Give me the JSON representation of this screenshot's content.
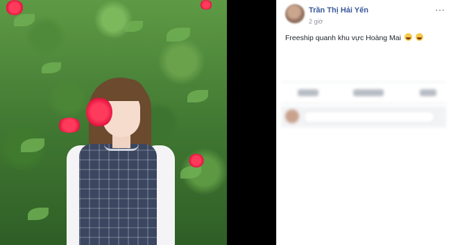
{
  "post": {
    "author": "Trần Thị Hải Yến",
    "time": "2 giờ",
    "more_icon": "⋯",
    "text": "Freeship quanh khu vực Hoàng Mai"
  },
  "icons": {
    "avatar": "avatar",
    "more": "more-options-icon",
    "emoji": "laughing-emoji-icon"
  },
  "colors": {
    "author_link": "#365899",
    "secondary_text": "#90949c",
    "body_text": "#1d2129"
  }
}
